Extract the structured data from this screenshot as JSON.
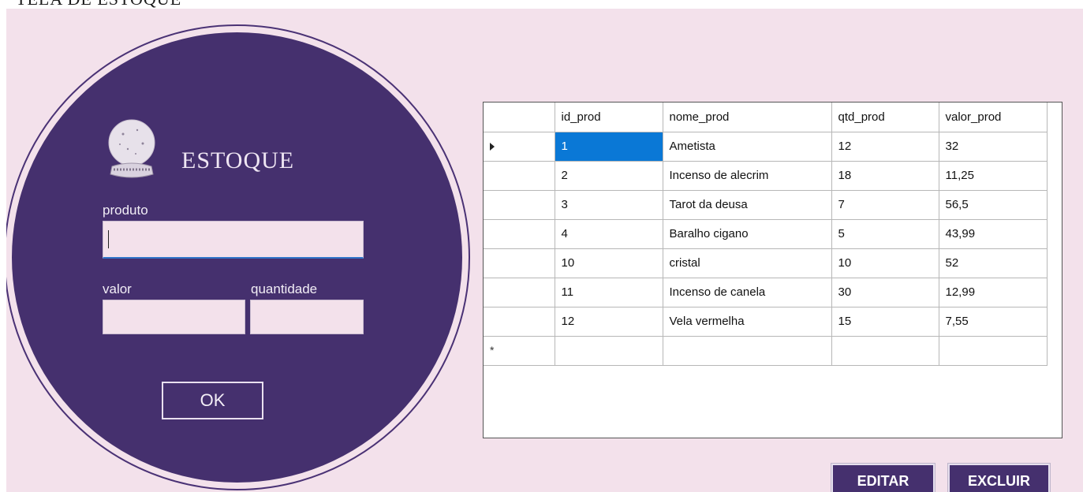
{
  "window": {
    "title": "TELA DE ESTOQUE"
  },
  "brand": {
    "label": "ESTOQUE",
    "icon": "crystal-ball-icon"
  },
  "form": {
    "produto_label": "produto",
    "produto_value": "",
    "valor_label": "valor",
    "valor_value": "",
    "quantidade_label": "quantidade",
    "quantidade_value": "",
    "ok_label": "OK"
  },
  "grid": {
    "columns": [
      "id_prod",
      "nome_prod",
      "qtd_prod",
      "valor_prod"
    ],
    "rows": [
      [
        "1",
        "Ametista",
        "12",
        "32"
      ],
      [
        "2",
        "Incenso de alecrim",
        "18",
        "11,25"
      ],
      [
        "3",
        "Tarot da deusa",
        "7",
        "56,5"
      ],
      [
        "4",
        "Baralho cigano",
        "5",
        "43,99"
      ],
      [
        "10",
        "cristal",
        "10",
        "52"
      ],
      [
        "11",
        "Incenso de canela",
        "30",
        "12,99"
      ],
      [
        "12",
        "Vela vermelha",
        "15",
        "7,55"
      ]
    ],
    "current_row_marker": "►",
    "new_row_marker": "*"
  },
  "actions": {
    "edit_label": "EDITAR",
    "delete_label": "EXCLUIR"
  },
  "colors": {
    "background": "#f3e1eb",
    "accent": "#45306e",
    "selection": "#0a78d6"
  }
}
